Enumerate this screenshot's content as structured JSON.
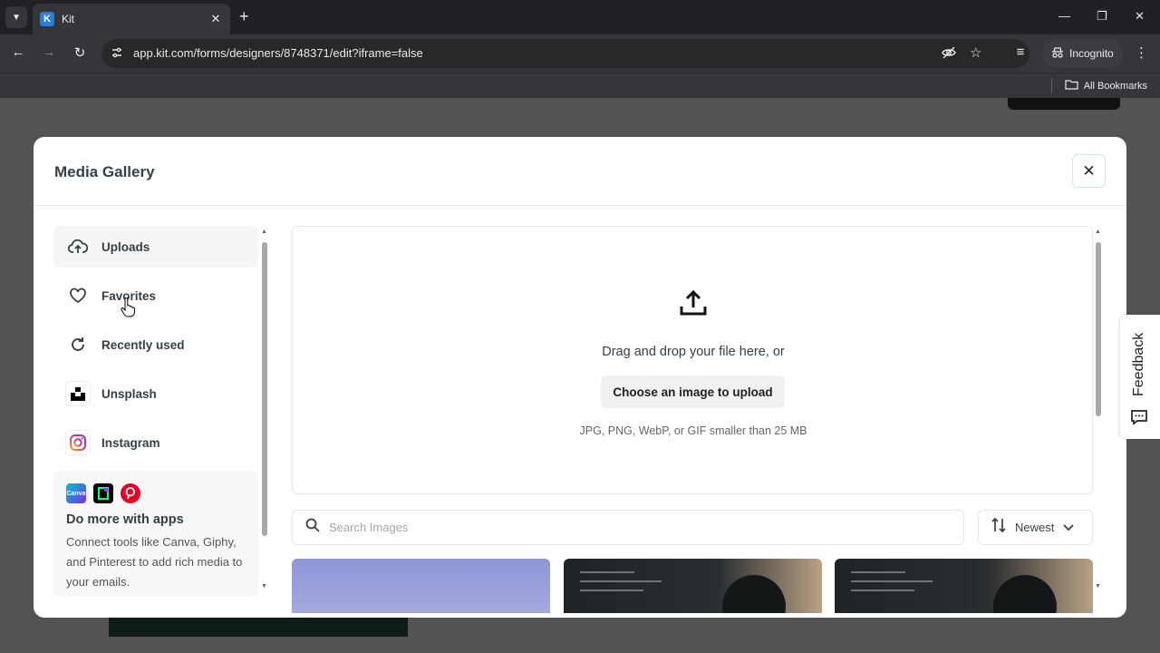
{
  "browser": {
    "tab_title": "Kit",
    "url": "app.kit.com/forms/designers/8748371/edit?iframe=false",
    "incognito_label": "Incognito",
    "bookmarks_label": "All Bookmarks"
  },
  "modal": {
    "title": "Media Gallery",
    "close_symbol": "✕"
  },
  "sidebar": {
    "items": [
      {
        "label": "Uploads",
        "icon": "cloud-upload-icon",
        "active": true
      },
      {
        "label": "Favorites",
        "icon": "heart-icon",
        "active": false
      },
      {
        "label": "Recently used",
        "icon": "refresh-icon",
        "active": false
      },
      {
        "label": "Unsplash",
        "icon": "unsplash-logo-icon",
        "active": false
      },
      {
        "label": "Instagram",
        "icon": "instagram-logo-icon",
        "active": false
      }
    ],
    "apps_box": {
      "app_icons": [
        "canva-logo-icon",
        "giphy-logo-icon",
        "pinterest-logo-icon"
      ],
      "canva_text": "Canva",
      "title": "Do more with apps",
      "description": "Connect tools like Canva, Giphy, and Pinterest to add rich media to your emails."
    }
  },
  "upload": {
    "drag_text": "Drag and drop your file here, or",
    "button_label": "Choose an image to upload",
    "hint": "JPG, PNG, WebP, or GIF smaller than 25 MB"
  },
  "search": {
    "placeholder": "Search Images",
    "value": ""
  },
  "sort": {
    "selected": "Newest"
  },
  "feedback": {
    "label": "Feedback"
  },
  "colors": {
    "modal_title": "#373f45",
    "overlay": "#535353",
    "favicon": "#2b7cd3"
  }
}
